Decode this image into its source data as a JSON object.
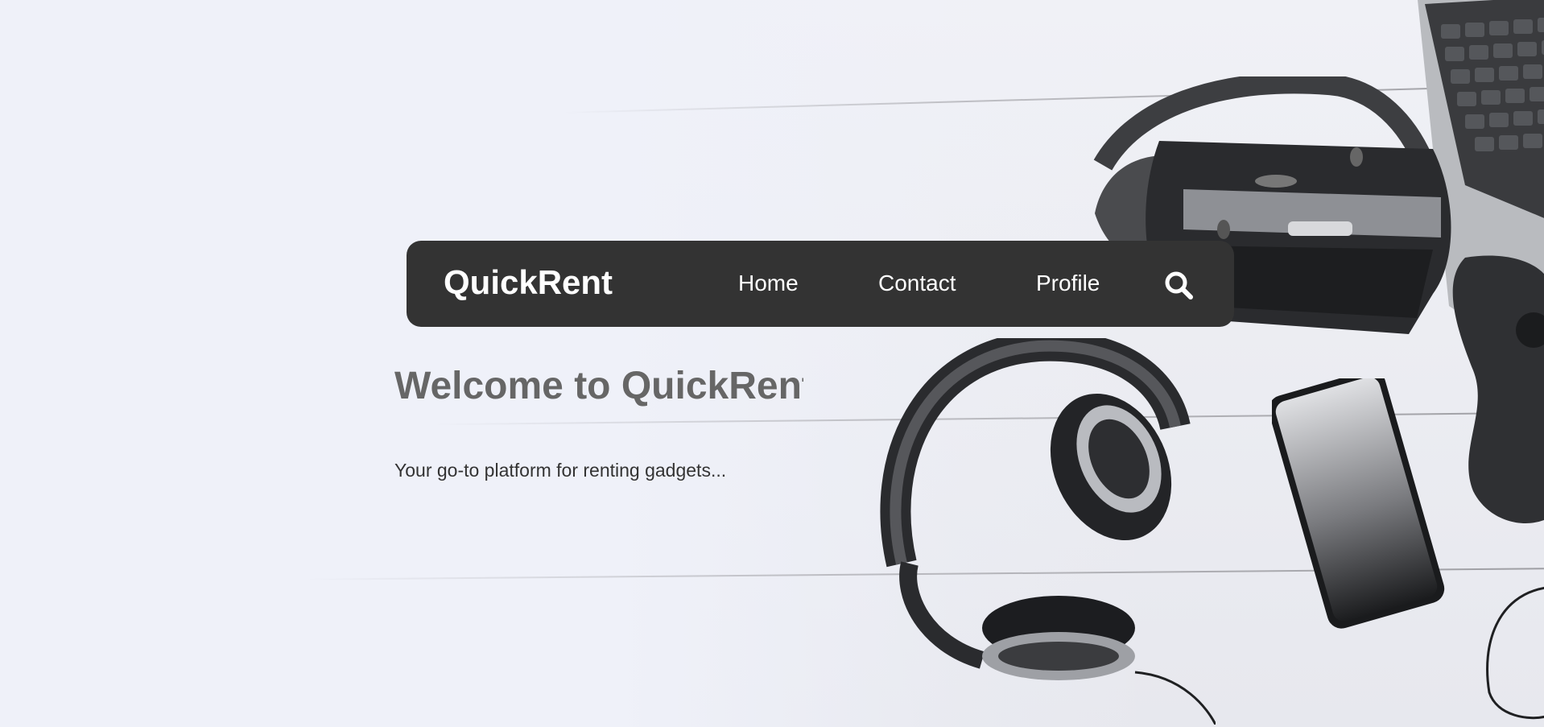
{
  "colors": {
    "page_background": "#eff1f9",
    "navbar_background": "#333333",
    "navbar_text": "#ffffff",
    "heading_text": "#666666",
    "body_text": "#333333"
  },
  "navbar": {
    "brand": "QuickRent",
    "links": [
      {
        "label": "Home"
      },
      {
        "label": "Contact"
      },
      {
        "label": "Profile"
      }
    ],
    "search_icon": "search-icon"
  },
  "hero": {
    "image_subject": "gadgets on white wooden table",
    "heading": "Welcome to QuickRent",
    "tagline": "Your go-to platform for renting gadgets..."
  }
}
